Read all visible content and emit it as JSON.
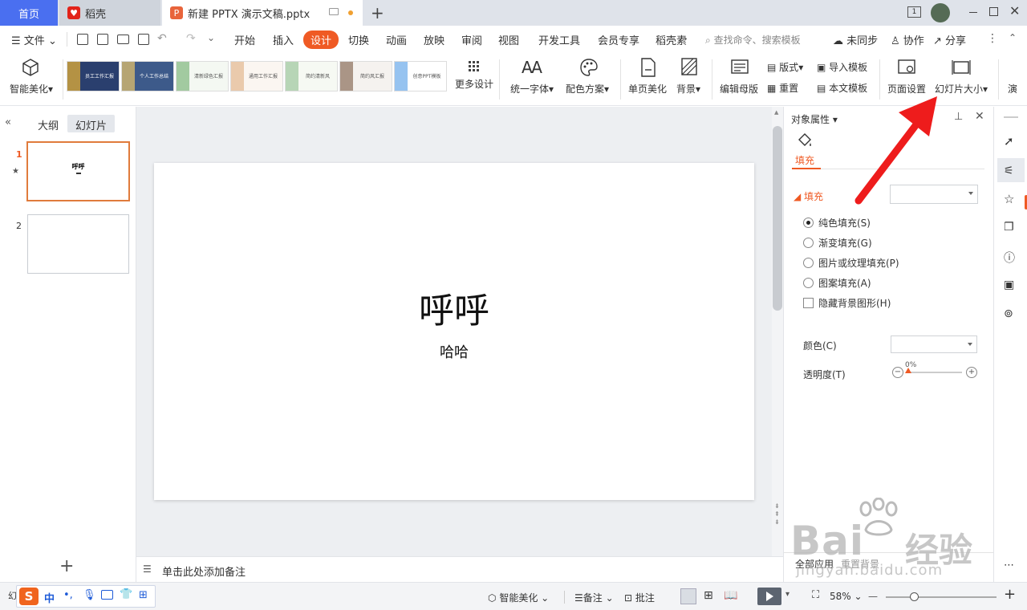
{
  "tabs": {
    "home": "首页",
    "daoke": "稻壳",
    "document": "新建 PPTX 演示文稿.pptx",
    "new_tab": "+"
  },
  "menubar": {
    "file": "文件",
    "items": [
      "开始",
      "插入",
      "设计",
      "切换",
      "动画",
      "放映",
      "审阅",
      "视图",
      "开发工具",
      "会员专享",
      "稻壳素"
    ],
    "search": "查找命令、搜索模板",
    "unsync": "未同步",
    "collab": "协作",
    "share": "分享"
  },
  "ribbon": {
    "smart_beautify": "智能美化",
    "more_design": "更多设计",
    "unify_font": "统一字体",
    "color_scheme": "配色方案",
    "single_page_beautify": "单页美化",
    "background": "背景",
    "edit_master": "编辑母版",
    "layout": "版式",
    "reset": "重置",
    "import_template": "导入模板",
    "text_template": "本文模板",
    "page_setup": "页面设置",
    "slide_size": "幻灯片大小",
    "cut_label": "演",
    "thumbnails": [
      {
        "name": "template-1",
        "color": "#2a3f6e",
        "accent": "#f0b732",
        "text": "员工工作汇报"
      },
      {
        "name": "template-2",
        "color": "#3d5a8a",
        "accent": "#e9c46a",
        "text": "个人工作总结"
      },
      {
        "name": "template-3",
        "color": "#f4f8f2",
        "accent": "#7fb77e",
        "text": "清新绿色汇报"
      },
      {
        "name": "template-4",
        "color": "#fbf6f1",
        "accent": "#e3b88f",
        "text": "通用工作汇报"
      },
      {
        "name": "template-5",
        "color": "#f6f9f3",
        "accent": "#9cc69b",
        "text": "简约清新风"
      },
      {
        "name": "template-6",
        "color": "#f5f2ef",
        "accent": "#8a6d5a",
        "text": "简约风汇报"
      },
      {
        "name": "template-7",
        "color": "#ffffff",
        "accent": "#6aa9e9",
        "text": "创意PPT模板"
      }
    ]
  },
  "left_panel": {
    "outline_tab": "大纲",
    "slides_tab": "幻灯片",
    "slides": [
      {
        "number": "1",
        "title": "呼呼",
        "active": true
      },
      {
        "number": "2",
        "title": "",
        "active": false
      }
    ],
    "add": "+"
  },
  "slide": {
    "title": "呼呼",
    "subtitle": "哈哈"
  },
  "notes": {
    "placeholder": "单击此处添加备注"
  },
  "properties": {
    "header": "对象属性",
    "tab_fill": "填充",
    "section_fill": "填充",
    "options": [
      {
        "label": "纯色填充(S)",
        "type": "radio",
        "checked": true
      },
      {
        "label": "渐变填充(G)",
        "type": "radio",
        "checked": false
      },
      {
        "label": "图片或纹理填充(P)",
        "type": "radio",
        "checked": false
      },
      {
        "label": "图案填充(A)",
        "type": "radio",
        "checked": false
      },
      {
        "label": "隐藏背景图形(H)",
        "type": "checkbox",
        "checked": false
      }
    ],
    "color_label": "颜色(C)",
    "transparency_label": "透明度(T)",
    "transparency_value": "0%",
    "apply_all": "全部应用",
    "reset_background": "重置背景"
  },
  "statusbar": {
    "ime_chinese": "中",
    "smart_beautify": "智能美化",
    "notes": "备注",
    "comments": "批注",
    "zoom": "58%",
    "zoom_minus": "—",
    "zoom_plus": "+"
  },
  "watermark": {
    "brand": "Bai",
    "brand_tail": "经验",
    "url": "jingyan.baidu.com"
  },
  "colors": {
    "accent_orange": "#ef5a24",
    "home_blue": "#4a6ff0",
    "arrow_red": "#ee1c1c"
  }
}
